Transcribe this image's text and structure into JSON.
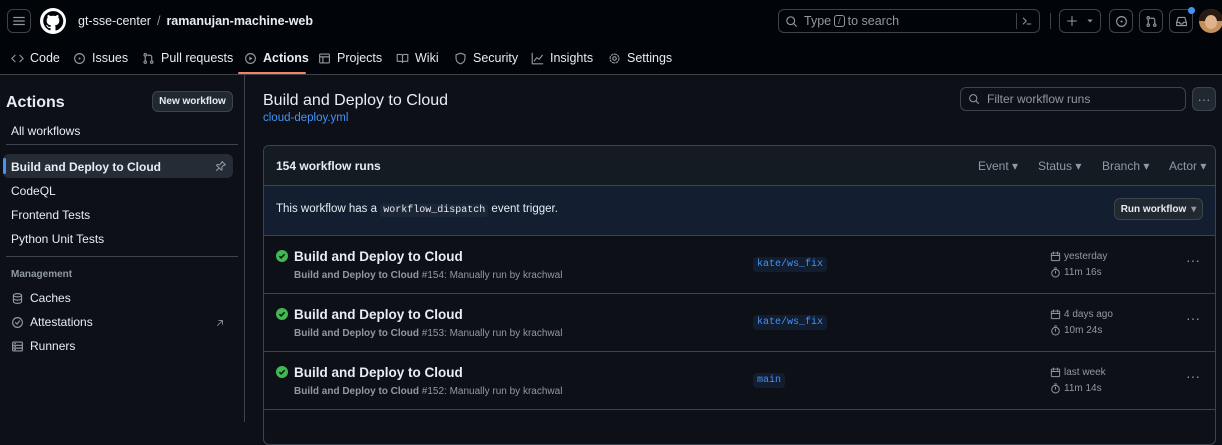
{
  "header": {
    "org": "gt-sse-center",
    "repo": "ramanujan-machine-web",
    "search_prefix": "Type",
    "search_key": "/",
    "search_suffix": "to search"
  },
  "tabs": [
    {
      "label": "Code",
      "icon": "code-icon"
    },
    {
      "label": "Issues",
      "icon": "issue-icon"
    },
    {
      "label": "Pull requests",
      "icon": "pull-request-icon"
    },
    {
      "label": "Actions",
      "icon": "play-icon"
    },
    {
      "label": "Projects",
      "icon": "table-icon"
    },
    {
      "label": "Wiki",
      "icon": "book-icon"
    },
    {
      "label": "Security",
      "icon": "shield-icon"
    },
    {
      "label": "Insights",
      "icon": "graph-icon"
    },
    {
      "label": "Settings",
      "icon": "gear-icon"
    }
  ],
  "sidebar": {
    "title": "Actions",
    "new_workflow": "New workflow",
    "all_workflows": "All workflows",
    "workflows": [
      "Build and Deploy to Cloud",
      "CodeQL",
      "Frontend Tests",
      "Python Unit Tests"
    ],
    "management_heading": "Management",
    "management": [
      {
        "label": "Caches",
        "icon": "cache-icon"
      },
      {
        "label": "Attestations",
        "icon": "verified-icon"
      },
      {
        "label": "Runners",
        "icon": "server-icon"
      }
    ]
  },
  "main": {
    "title": "Build and Deploy to Cloud",
    "file": "cloud-deploy.yml",
    "filter_placeholder": "Filter workflow runs",
    "runs_count": "154 workflow runs",
    "filters": [
      "Event",
      "Status",
      "Branch",
      "Actor"
    ],
    "dispatch_prefix": "This workflow has a",
    "dispatch_code": "workflow_dispatch",
    "dispatch_suffix": "event trigger.",
    "run_workflow": "Run workflow",
    "runs": [
      {
        "title": "Build and Deploy to Cloud",
        "wf": "Build and Deploy to Cloud",
        "num": "#154",
        "rest": ": Manually run by krachwal",
        "branch": "kate/ws_fix",
        "date": "yesterday",
        "duration": "11m 16s"
      },
      {
        "title": "Build and Deploy to Cloud",
        "wf": "Build and Deploy to Cloud",
        "num": "#153",
        "rest": ": Manually run by krachwal",
        "branch": "kate/ws_fix",
        "date": "4 days ago",
        "duration": "10m 24s"
      },
      {
        "title": "Build and Deploy to Cloud",
        "wf": "Build and Deploy to Cloud",
        "num": "#152",
        "rest": ": Manually run by krachwal",
        "branch": "main",
        "date": "last week",
        "duration": "11m 14s"
      }
    ]
  },
  "colors": {
    "accent": "#f78166",
    "link": "#4493f8",
    "success": "#3fb950"
  }
}
